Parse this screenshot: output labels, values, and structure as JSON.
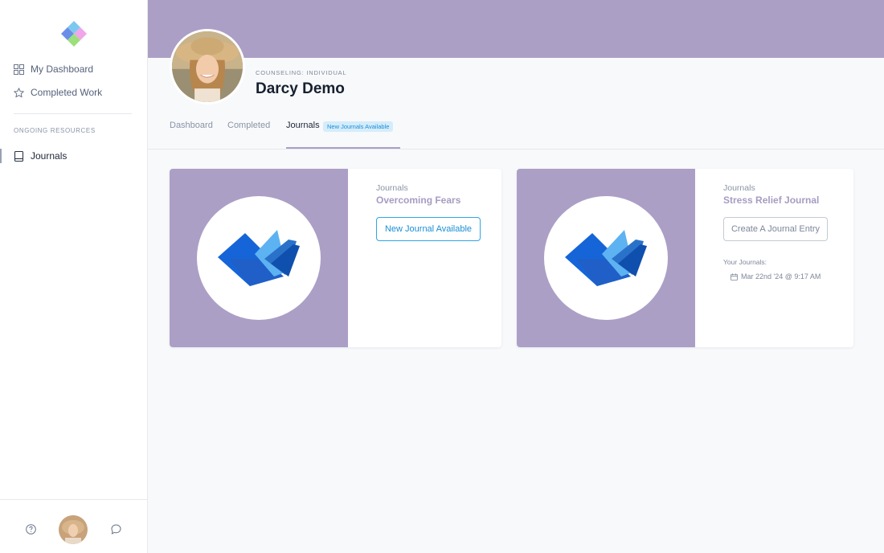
{
  "sidebar": {
    "nav": [
      {
        "label": "My Dashboard",
        "icon": "grid-icon"
      },
      {
        "label": "Completed Work",
        "icon": "star-icon"
      }
    ],
    "section_label": "ONGOING RESOURCES",
    "resources": [
      {
        "label": "Journals",
        "icon": "book-icon"
      }
    ]
  },
  "profile": {
    "program": "COUNSELING: INDIVIDUAL",
    "name": "Darcy Demo"
  },
  "tabs": [
    {
      "label": "Dashboard"
    },
    {
      "label": "Completed"
    },
    {
      "label": "Journals",
      "badge": "New Journals Available",
      "active": true
    }
  ],
  "cards": [
    {
      "type": "Journals",
      "title": "Overcoming Fears",
      "button": "New Journal Available"
    },
    {
      "type": "Journals",
      "title": "Stress Relief Journal",
      "button": "Create A Journal Entry",
      "entries_label": "Your Journals:",
      "entries": [
        "Mar 22nd '24 @ 9:17 AM"
      ]
    }
  ],
  "colors": {
    "brand_purple": "#ac9fc6",
    "accent_blue": "#1a8fd6",
    "badge_bg": "#d5ecfb"
  }
}
